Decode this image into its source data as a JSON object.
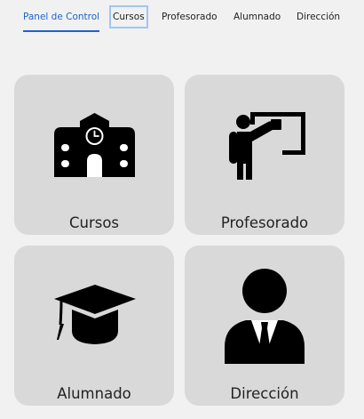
{
  "nav": {
    "tabs": [
      {
        "label": "Panel de Control"
      },
      {
        "label": "Cursos"
      },
      {
        "label": "Profesorado"
      },
      {
        "label": "Alumnado"
      },
      {
        "label": "Dirección"
      }
    ],
    "active_tab": "Panel de Control",
    "focused_tab": "Cursos"
  },
  "cards": [
    {
      "label": "Cursos",
      "icon": "school-icon"
    },
    {
      "label": "Profesorado",
      "icon": "teacher-icon"
    },
    {
      "label": "Alumnado",
      "icon": "graduation-cap-icon"
    },
    {
      "label": "Dirección",
      "icon": "manager-icon"
    }
  ],
  "colors": {
    "accent": "#1d62c9",
    "focus_ring": "#9fc7f3",
    "card_bg": "#d9d9d9",
    "page_bg": "#f1f1f1",
    "icon": "#000000"
  }
}
